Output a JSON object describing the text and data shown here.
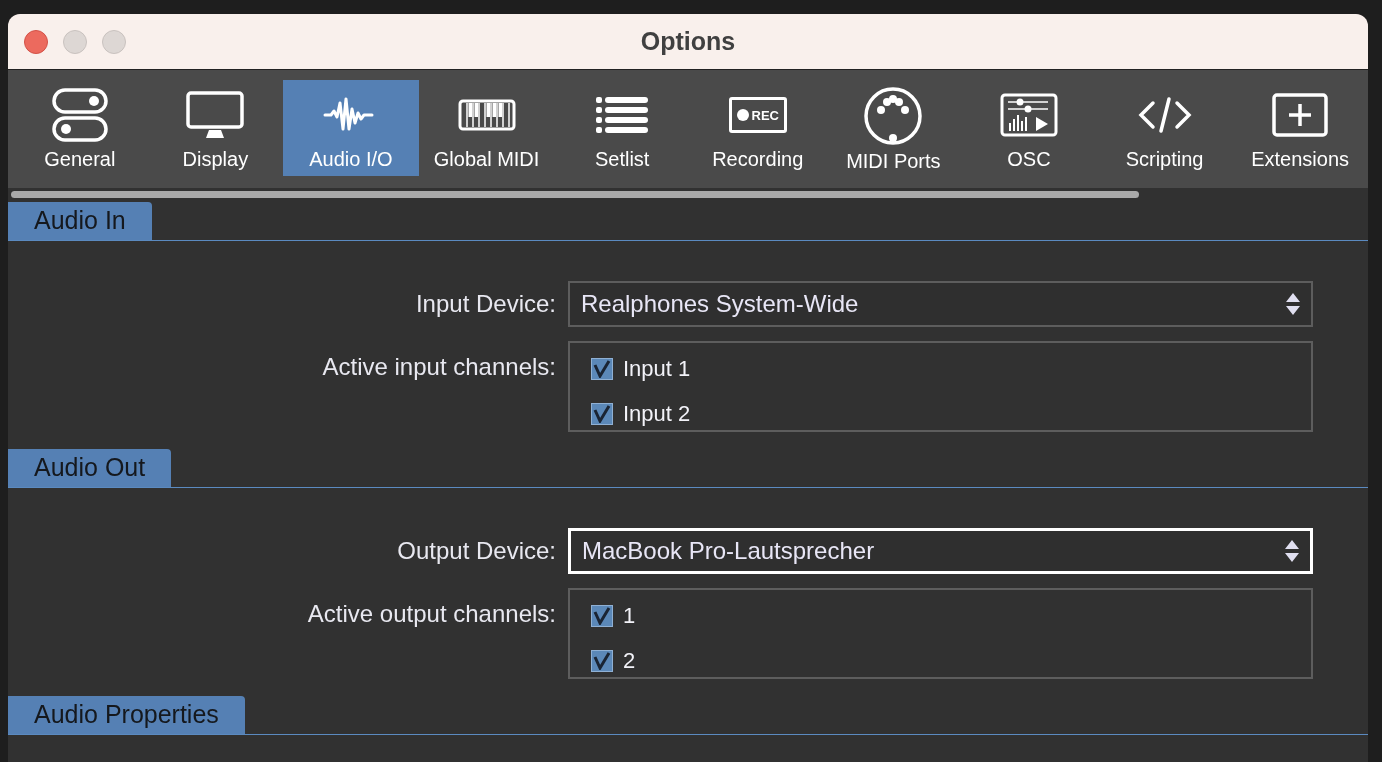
{
  "window": {
    "title": "Options"
  },
  "tabs": [
    {
      "label": "General",
      "selected": false
    },
    {
      "label": "Display",
      "selected": false
    },
    {
      "label": "Audio I/O",
      "selected": true
    },
    {
      "label": "Global MIDI",
      "selected": false
    },
    {
      "label": "Setlist",
      "selected": false
    },
    {
      "label": "Recording",
      "selected": false,
      "icon_text": "REC"
    },
    {
      "label": "MIDI Ports",
      "selected": false
    },
    {
      "label": "OSC",
      "selected": false
    },
    {
      "label": "Scripting",
      "selected": false
    },
    {
      "label": "Extensions",
      "selected": false
    }
  ],
  "sections": [
    {
      "title": "Audio In",
      "device_label": "Input Device:",
      "device": "Realphones System-Wide",
      "focused": false,
      "channels_label": "Active input channels:",
      "channels": [
        {
          "label": "Input 1",
          "checked": true
        },
        {
          "label": "Input 2",
          "checked": true
        }
      ]
    },
    {
      "title": "Audio Out",
      "device_label": "Output Device:",
      "device": "MacBook Pro-Lautsprecher",
      "focused": true,
      "channels_label": "Active output channels:",
      "channels": [
        {
          "label": "1",
          "checked": true
        },
        {
          "label": "2",
          "checked": true
        }
      ]
    },
    {
      "title": "Audio Properties"
    }
  ]
}
